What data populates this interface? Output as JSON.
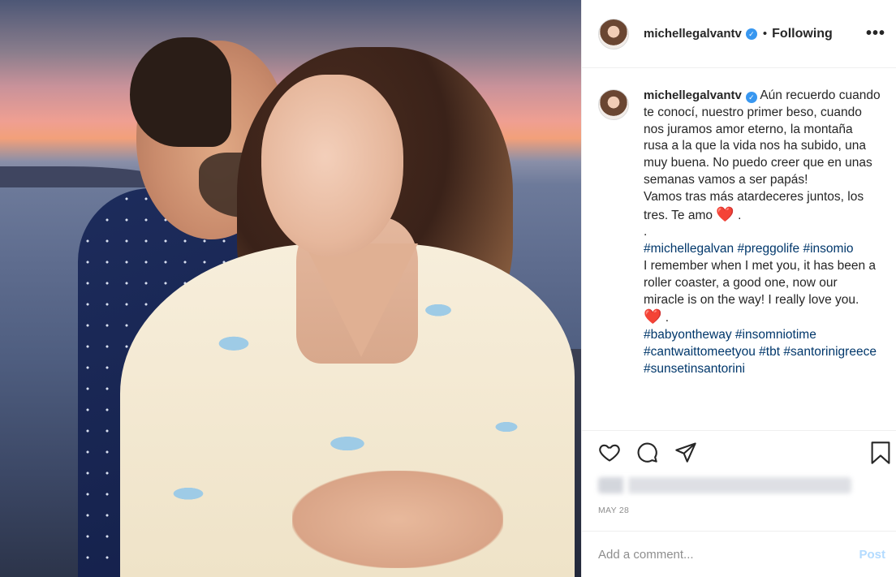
{
  "post": {
    "username": "michellegalvantv",
    "follow_status": "Following",
    "dot": "•",
    "more_label": "•••"
  },
  "caption": {
    "username": "michellegalvantv",
    "text_es": "Aún recuerdo cuando te conocí, nuestro primer beso, cuando nos juramos amor eterno, la montaña rusa a la que la vida nos ha subido, una muy buena. No puedo creer que en unas semanas vamos a ser papás!",
    "text_es_2": "Vamos tras más atardeceres juntos, los tres. Te amo",
    "heart": "❤️",
    "period": ".",
    "separator": ".",
    "hashtags_1": [
      "#michellegalvan",
      "#preggolife",
      "#insomio"
    ],
    "text_en": "I remember when I met you, it has been a roller coaster, a good one, now our miracle is on the way! I really love you.",
    "hashtags_2": [
      "#babyontheway",
      "#insomniotime",
      "#cantwaittomeetyou",
      "#tbt",
      "#santorinigreece",
      "#sunsetinsantorini"
    ]
  },
  "actions": {
    "like_icon": "heart-outline-icon",
    "comment_icon": "comment-bubble-icon",
    "share_icon": "paper-plane-icon",
    "save_icon": "bookmark-icon"
  },
  "date": "MAY 28",
  "comment_box": {
    "placeholder": "Add a comment...",
    "post_label": "Post"
  },
  "colors": {
    "verified": "#3897f0",
    "hashtag": "#00376b",
    "post_disabled": "#b3dbff",
    "heart": "#ed2a3a"
  }
}
